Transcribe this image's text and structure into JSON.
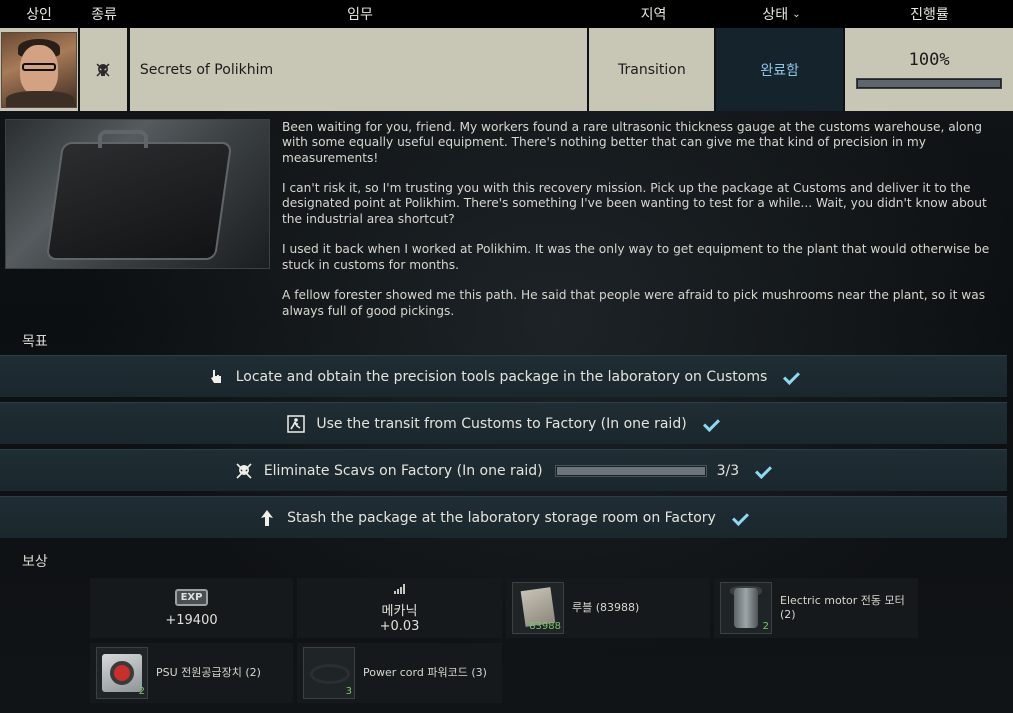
{
  "header": {
    "trader": "상인",
    "type": "종류",
    "task": "임무",
    "location": "지역",
    "status": "상태",
    "progress": "진행률"
  },
  "quest": {
    "type_icon": "skull-icon",
    "name": "Secrets of Polikhim",
    "location": "Transition",
    "status": "완료함",
    "progress_text": "100%",
    "progress_value": 1.0
  },
  "description": [
    "Been waiting for you, friend. My workers found a rare ultrasonic thickness gauge at the customs warehouse, along with some equally useful equipment. There's nothing better that can give me that kind of precision in my measurements!",
    "I can't risk it, so I'm trusting you with this recovery mission. Pick up the package at Customs and deliver it to the designated point at Polikhim. There's something I've been wanting to test for a while... Wait, you didn't know about the industrial area shortcut?",
    "I used it back when I worked at Polikhim. It was the only way to get equipment to the plant that would otherwise be stuck in customs for months.",
    "A fellow forester showed me this path. He said that people were afraid to pick mushrooms near the plant, so it was always full of good pickings."
  ],
  "objectives_label": "목표",
  "objectives": [
    {
      "icon": "hand-pointer-icon",
      "text": "Locate and obtain the precision tools package in the laboratory on Customs"
    },
    {
      "icon": "exit-icon",
      "text": "Use the transit from Customs to Factory (In one raid)"
    },
    {
      "icon": "skull-icon",
      "text": "Eliminate Scavs on Factory (In one raid)",
      "count": "3/3",
      "progress_value": 1.0
    },
    {
      "icon": "arrow-up-icon",
      "text": "Stash the package at the laboratory storage room on Factory"
    }
  ],
  "rewards_label": "보상",
  "rewards": {
    "exp_badge": "EXP",
    "exp_value": "+19400",
    "skill_name": "메카닉",
    "skill_value": "+0.03",
    "items": [
      {
        "icon": "rubles-icon",
        "label": "루블  (83988)",
        "count": "83988"
      },
      {
        "icon": "electric-motor-icon",
        "label": "Electric motor 전동 모터",
        "qty": "(2)",
        "count": "2"
      },
      {
        "icon": "psu-icon",
        "label": "PSU 전원공급장치  (2)",
        "count": "2"
      },
      {
        "icon": "power-cord-icon",
        "label": "Power cord 파워코드  (3)",
        "count": "3"
      }
    ]
  }
}
